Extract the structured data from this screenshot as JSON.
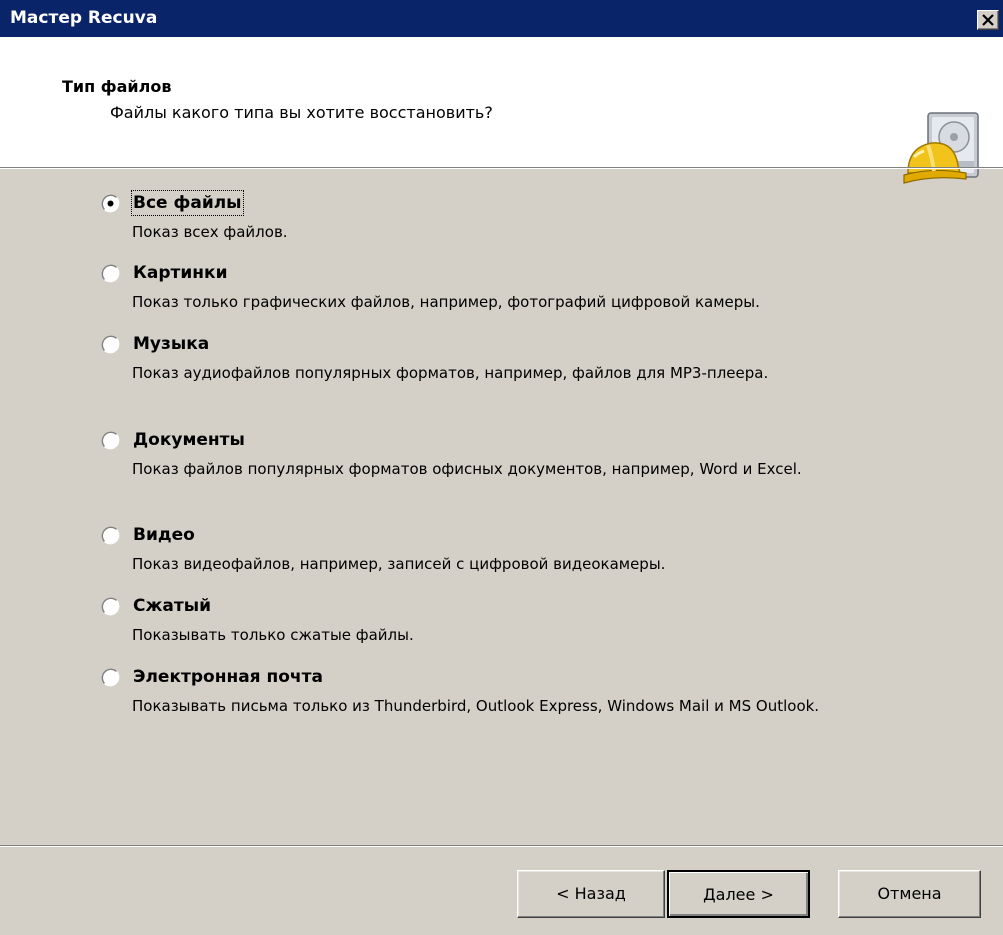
{
  "window": {
    "title": "Мастер Recuva"
  },
  "header": {
    "title": "Тип файлов",
    "subtitle": "Файлы какого типа вы хотите восстановить?"
  },
  "options": [
    {
      "label": "Все файлы",
      "description": "Показ всех файлов.",
      "selected": true
    },
    {
      "label": "Картинки",
      "description": "Показ только графических файлов, например, фотографий цифровой камеры.",
      "selected": false
    },
    {
      "label": "Музыка",
      "description": "Показ аудиофайлов популярных форматов, например, файлов для MP3-плеера.",
      "selected": false
    },
    {
      "label": "Документы",
      "description": "Показ файлов популярных форматов офисных документов, например, Word и Excel.",
      "selected": false
    },
    {
      "label": "Видео",
      "description": "Показ видеофайлов, например, записей с цифровой видеокамеры.",
      "selected": false
    },
    {
      "label": "Сжатый",
      "description": "Показывать только сжатые файлы.",
      "selected": false
    },
    {
      "label": "Электронная почта",
      "description": "Показывать письма только из Thunderbird, Outlook Express, Windows Mail и MS Outlook.",
      "selected": false
    }
  ],
  "buttons": {
    "back": "< Назад",
    "next": "Далее >",
    "cancel": "Отмена"
  },
  "icons": {
    "close": "close-icon",
    "logo": "recuva-logo-icon",
    "radio": "radio-icon"
  },
  "colors": {
    "titlebar": "#0a246a",
    "face": "#d4d0c8",
    "header": "#ffffff"
  }
}
